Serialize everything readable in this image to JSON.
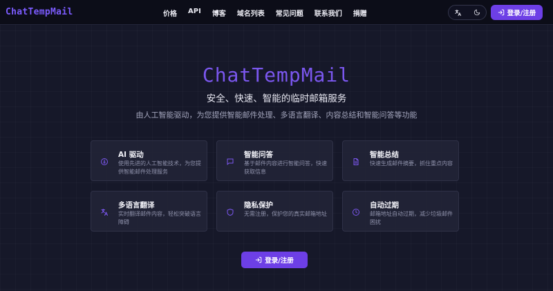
{
  "header": {
    "logo": "ChatTempMail",
    "nav": [
      "价格",
      "API",
      "博客",
      "域名列表",
      "常见问题",
      "联系我们",
      "捐赠"
    ],
    "translate_icon": "translate-icon",
    "theme_icon": "moon-icon",
    "login_label": "登录/注册"
  },
  "hero": {
    "title": "ChatTempMail",
    "subtitle": "安全、快速、智能的临时邮箱服务",
    "description": "由人工智能驱动，为您提供智能邮件处理、多语言翻译、内容总结和智能问答等功能"
  },
  "features": [
    {
      "icon": "bulb-icon",
      "title": "AI 驱动",
      "desc": "使用先进的人工智能技术，为您提供智能邮件处理服务"
    },
    {
      "icon": "chat-icon",
      "title": "智能问答",
      "desc": "基于邮件内容进行智能问答，快速获取信息"
    },
    {
      "icon": "document-icon",
      "title": "智能总结",
      "desc": "快速生成邮件摘要，抓住重点内容"
    },
    {
      "icon": "translate-icon",
      "title": "多语言翻译",
      "desc": "实时翻译邮件内容，轻松突破语言障碍"
    },
    {
      "icon": "shield-icon",
      "title": "隐私保护",
      "desc": "无需注册，保护您的真实邮箱地址"
    },
    {
      "icon": "clock-icon",
      "title": "自动过期",
      "desc": "邮箱地址自动过期，减少垃圾邮件困扰"
    }
  ],
  "cta": {
    "label": "登录/注册"
  },
  "colors": {
    "accent": "#6d3fe6",
    "brand_text": "#7b57ef",
    "background": "#161829"
  }
}
